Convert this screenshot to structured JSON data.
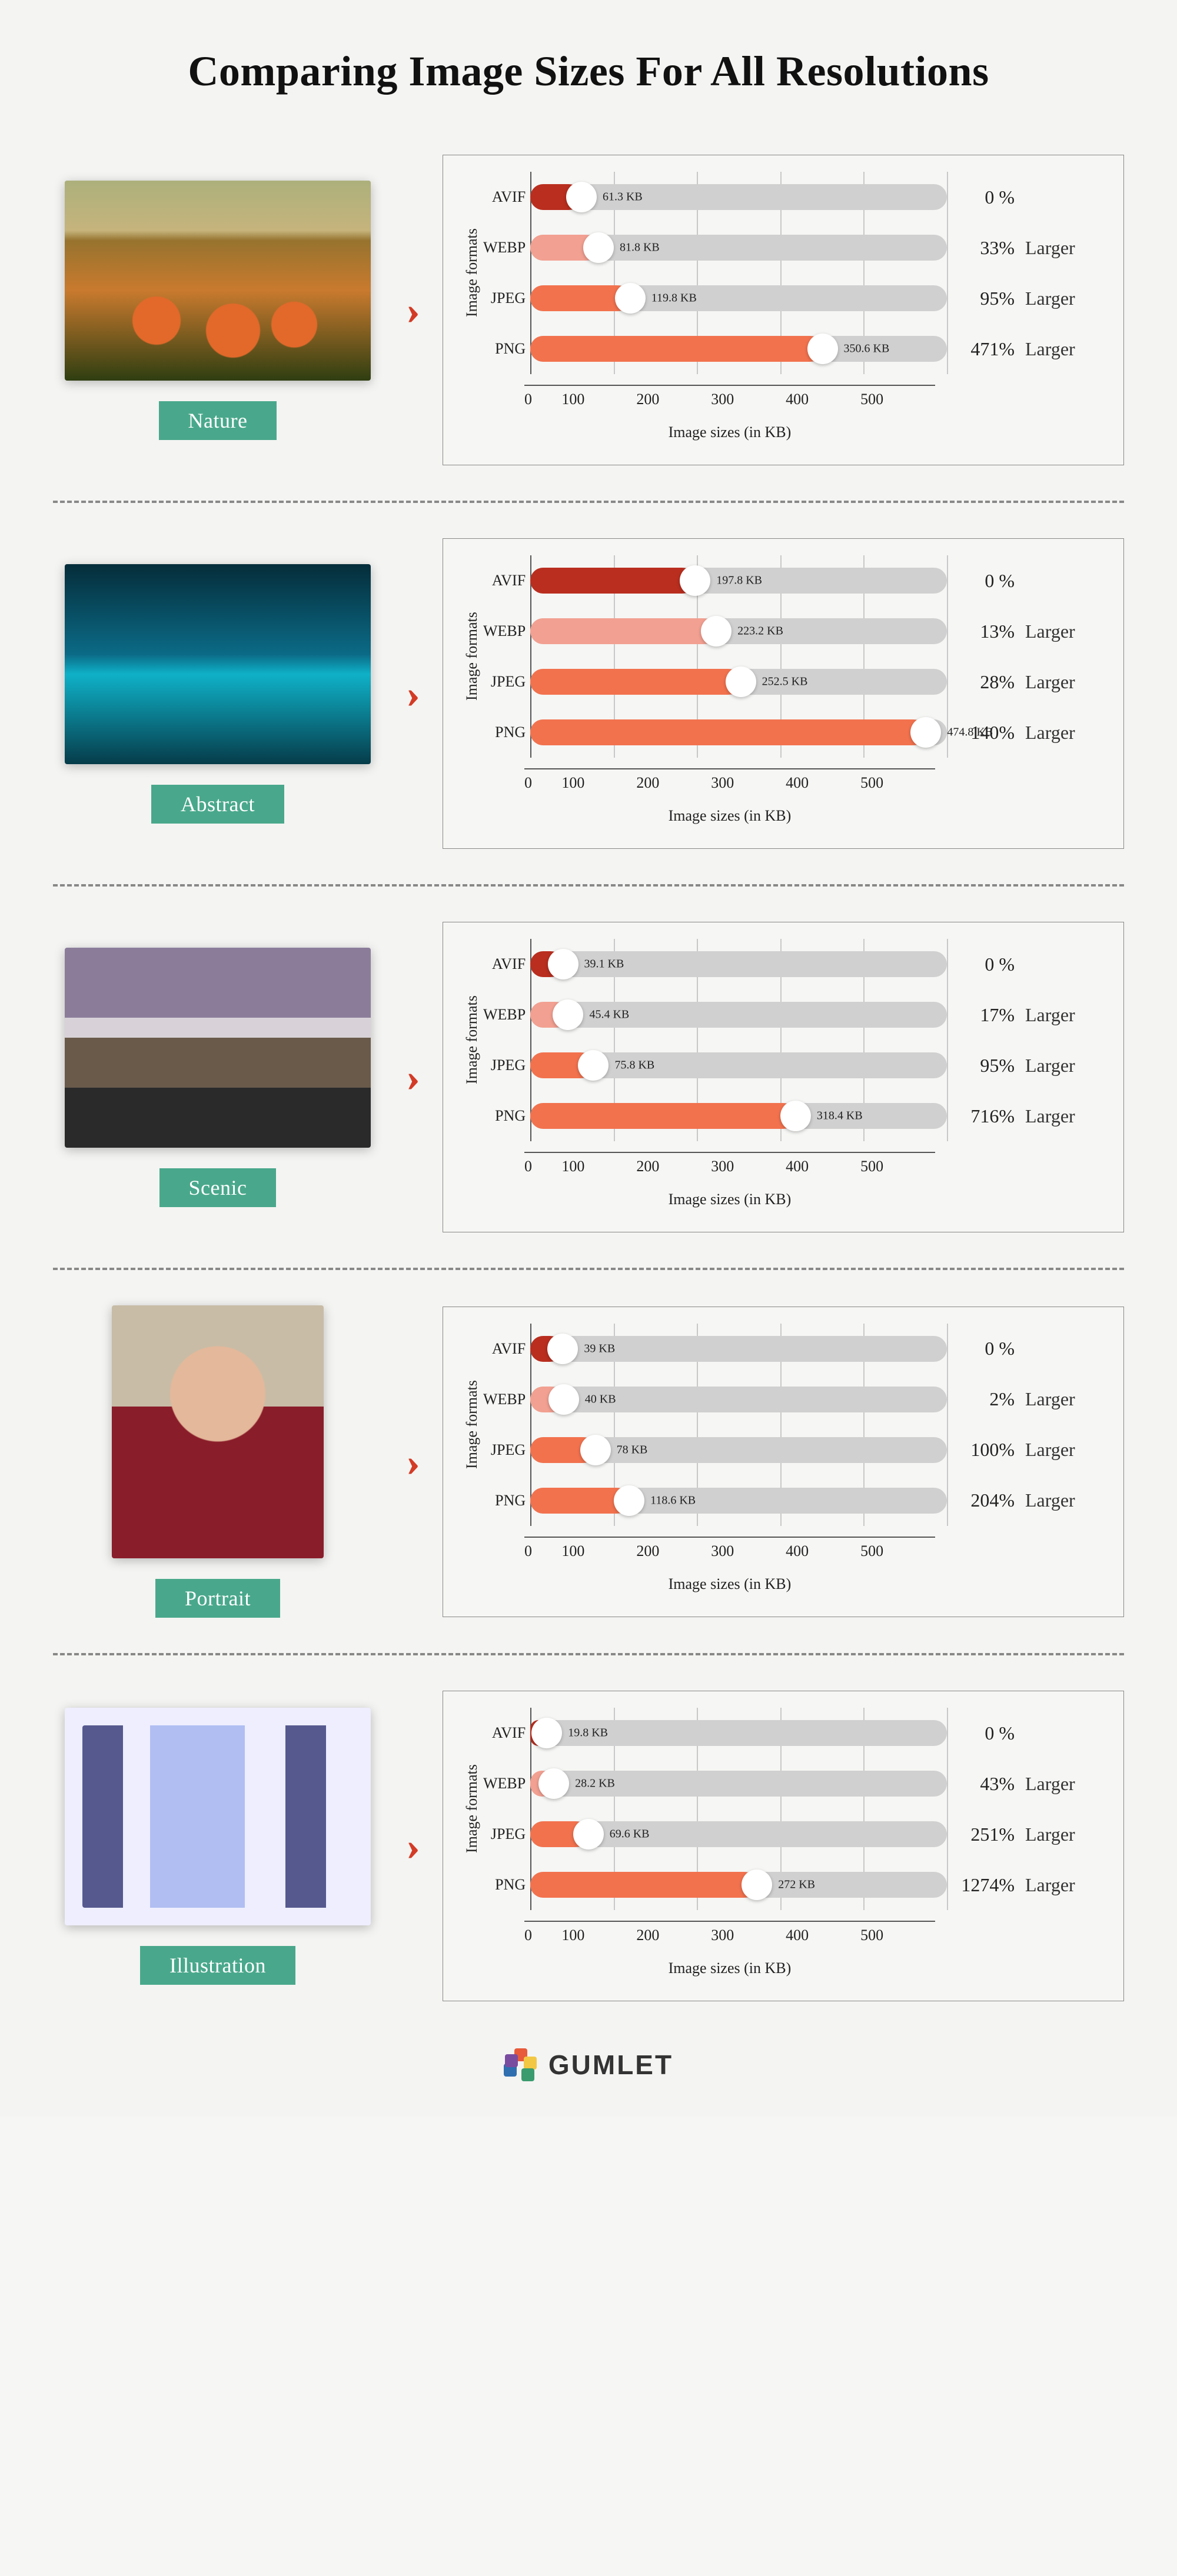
{
  "title": "Comparing Image Sizes For All Resolutions",
  "axis": {
    "y_label": "Image formats",
    "x_label": "Image sizes (in KB)",
    "x_ticks": [
      0,
      100,
      200,
      300,
      400,
      500
    ],
    "x_max": 500
  },
  "formats": [
    "AVIF",
    "WEBP",
    "JPEG",
    "PNG"
  ],
  "larger_text": "Larger",
  "colors": {
    "avif": "#b92e1f",
    "webp": "#f2a091",
    "jpeg": "#f2724e",
    "png": "#f2724e"
  },
  "footer_brand": "GUMLET",
  "sections": [
    {
      "name": "Nature",
      "thumb_class": "img-nature",
      "thumb_shape": "land",
      "bars": [
        {
          "fmt": "AVIF",
          "kb": 61.3,
          "label": "61.3 KB",
          "pct": "0 %",
          "larger": false,
          "color": "avif"
        },
        {
          "fmt": "WEBP",
          "kb": 81.8,
          "label": "81.8  KB",
          "pct": "33%",
          "larger": true,
          "color": "webp"
        },
        {
          "fmt": "JPEG",
          "kb": 119.8,
          "label": "119.8 KB",
          "pct": "95%",
          "larger": true,
          "color": "jpeg"
        },
        {
          "fmt": "PNG",
          "kb": 350.6,
          "label": "350.6 KB",
          "pct": "471%",
          "larger": true,
          "color": "png"
        }
      ]
    },
    {
      "name": "Abstract",
      "thumb_class": "img-abstract",
      "thumb_shape": "land",
      "bars": [
        {
          "fmt": "AVIF",
          "kb": 197.8,
          "label": "197.8 KB",
          "pct": "0 %",
          "larger": false,
          "color": "avif"
        },
        {
          "fmt": "WEBP",
          "kb": 223.2,
          "label": "223.2 KB",
          "pct": "13%",
          "larger": true,
          "color": "webp"
        },
        {
          "fmt": "JPEG",
          "kb": 252.5,
          "label": "252.5 KB",
          "pct": "28%",
          "larger": true,
          "color": "jpeg"
        },
        {
          "fmt": "PNG",
          "kb": 474.8,
          "label": "474.8 KB",
          "pct": "140%",
          "larger": true,
          "color": "png"
        }
      ]
    },
    {
      "name": "Scenic",
      "thumb_class": "img-scenic",
      "thumb_shape": "land",
      "bars": [
        {
          "fmt": "AVIF",
          "kb": 39.1,
          "label": "39.1 KB",
          "pct": "0 %",
          "larger": false,
          "color": "avif"
        },
        {
          "fmt": "WEBP",
          "kb": 45.4,
          "label": "45.4  KB",
          "pct": "17%",
          "larger": true,
          "color": "webp"
        },
        {
          "fmt": "JPEG",
          "kb": 75.8,
          "label": "75.8  KB",
          "pct": "95%",
          "larger": true,
          "color": "jpeg"
        },
        {
          "fmt": "PNG",
          "kb": 318.4,
          "label": "318.4 KB",
          "pct": "716%",
          "larger": true,
          "color": "png"
        }
      ]
    },
    {
      "name": "Portrait",
      "thumb_class": "img-portrait",
      "thumb_shape": "portrait",
      "bars": [
        {
          "fmt": "AVIF",
          "kb": 39,
          "label": "39 KB",
          "pct": "0 %",
          "larger": false,
          "color": "avif"
        },
        {
          "fmt": "WEBP",
          "kb": 40,
          "label": "40  KB",
          "pct": "2%",
          "larger": true,
          "color": "webp"
        },
        {
          "fmt": "JPEG",
          "kb": 78,
          "label": "78  KB",
          "pct": "100%",
          "larger": true,
          "color": "jpeg"
        },
        {
          "fmt": "PNG",
          "kb": 118.6,
          "label": "118.6 KB",
          "pct": "204%",
          "larger": true,
          "color": "png"
        }
      ]
    },
    {
      "name": "Illustration",
      "thumb_class": "img-illus",
      "thumb_shape": "illus",
      "bars": [
        {
          "fmt": "AVIF",
          "kb": 19.8,
          "label": "19.8 KB",
          "pct": "0 %",
          "larger": false,
          "color": "avif"
        },
        {
          "fmt": "WEBP",
          "kb": 28.2,
          "label": "28.2 KB",
          "pct": "43%",
          "larger": true,
          "color": "webp"
        },
        {
          "fmt": "JPEG",
          "kb": 69.6,
          "label": "69.6 KB",
          "pct": "251%",
          "larger": true,
          "color": "jpeg"
        },
        {
          "fmt": "PNG",
          "kb": 272,
          "label": "272  KB",
          "pct": "1274%",
          "larger": true,
          "color": "png"
        }
      ]
    }
  ],
  "chart_data": [
    {
      "type": "bar",
      "title": "Nature",
      "xlabel": "Image sizes (in KB)",
      "ylabel": "Image formats",
      "xlim": [
        0,
        500
      ],
      "categories": [
        "AVIF",
        "WEBP",
        "JPEG",
        "PNG"
      ],
      "series": [
        {
          "name": "size_kb",
          "values": [
            61.3,
            81.8,
            119.8,
            350.6
          ]
        },
        {
          "name": "pct_larger_vs_avif",
          "values": [
            0,
            33,
            95,
            471
          ]
        }
      ]
    },
    {
      "type": "bar",
      "title": "Abstract",
      "xlabel": "Image sizes (in KB)",
      "ylabel": "Image formats",
      "xlim": [
        0,
        500
      ],
      "categories": [
        "AVIF",
        "WEBP",
        "JPEG",
        "PNG"
      ],
      "series": [
        {
          "name": "size_kb",
          "values": [
            197.8,
            223.2,
            252.5,
            474.8
          ]
        },
        {
          "name": "pct_larger_vs_avif",
          "values": [
            0,
            13,
            28,
            140
          ]
        }
      ]
    },
    {
      "type": "bar",
      "title": "Scenic",
      "xlabel": "Image sizes (in KB)",
      "ylabel": "Image formats",
      "xlim": [
        0,
        500
      ],
      "categories": [
        "AVIF",
        "WEBP",
        "JPEG",
        "PNG"
      ],
      "series": [
        {
          "name": "size_kb",
          "values": [
            39.1,
            45.4,
            75.8,
            318.4
          ]
        },
        {
          "name": "pct_larger_vs_avif",
          "values": [
            0,
            17,
            95,
            716
          ]
        }
      ]
    },
    {
      "type": "bar",
      "title": "Portrait",
      "xlabel": "Image sizes (in KB)",
      "ylabel": "Image formats",
      "xlim": [
        0,
        500
      ],
      "categories": [
        "AVIF",
        "WEBP",
        "JPEG",
        "PNG"
      ],
      "series": [
        {
          "name": "size_kb",
          "values": [
            39,
            40,
            78,
            118.6
          ]
        },
        {
          "name": "pct_larger_vs_avif",
          "values": [
            0,
            2,
            100,
            204
          ]
        }
      ]
    },
    {
      "type": "bar",
      "title": "Illustration",
      "xlabel": "Image sizes (in KB)",
      "ylabel": "Image formats",
      "xlim": [
        0,
        500
      ],
      "categories": [
        "AVIF",
        "WEBP",
        "JPEG",
        "PNG"
      ],
      "series": [
        {
          "name": "size_kb",
          "values": [
            19.8,
            28.2,
            69.6,
            272
          ]
        },
        {
          "name": "pct_larger_vs_avif",
          "values": [
            0,
            43,
            251,
            1274
          ]
        }
      ]
    }
  ]
}
